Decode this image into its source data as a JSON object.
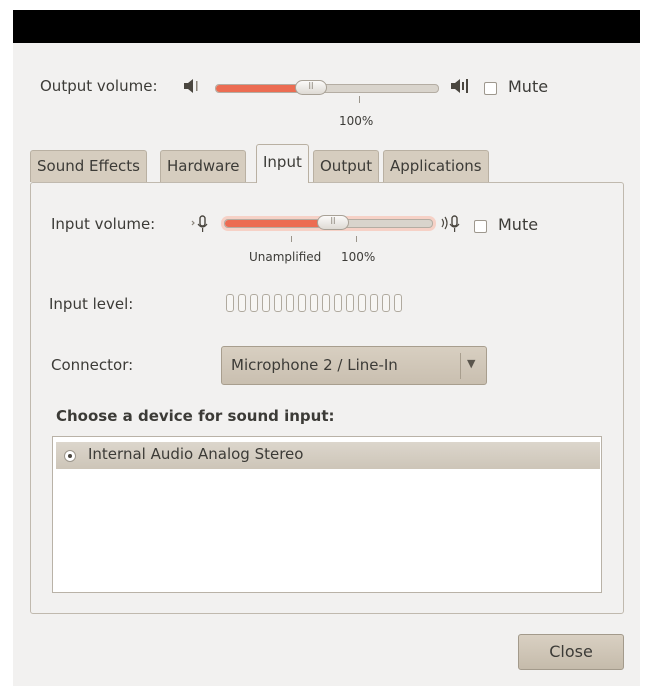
{
  "output": {
    "label": "Output volume:",
    "value_label": "100%",
    "value_percent": 43,
    "mute_label": "Mute",
    "muted": false
  },
  "tabs": [
    "Sound Effects",
    "Hardware",
    "Input",
    "Output",
    "Applications"
  ],
  "active_tab": "Input",
  "input": {
    "volume_label": "Input volume:",
    "value_percent": 52,
    "unamplified_label": "Unamplified",
    "value_label": "100%",
    "mute_label": "Mute",
    "muted": false,
    "level_label": "Input level:",
    "connector_label": "Connector:",
    "connector_value": "Microphone 2 / Line-In",
    "device_heading": "Choose a device for sound input:",
    "devices": [
      "Internal Audio Analog Stereo"
    ]
  },
  "buttons": {
    "close": "Close"
  },
  "icons": {
    "speaker_low": "speaker-low-icon",
    "speaker_high": "speaker-high-icon",
    "mic_low": "microphone-low-icon",
    "mic_high": "microphone-high-icon",
    "dropdown": "triangle-down-icon"
  },
  "colors": {
    "accent": "#ec6c52",
    "window_bg": "#f2f1f0",
    "tab_bg": "#d6cdbf"
  }
}
